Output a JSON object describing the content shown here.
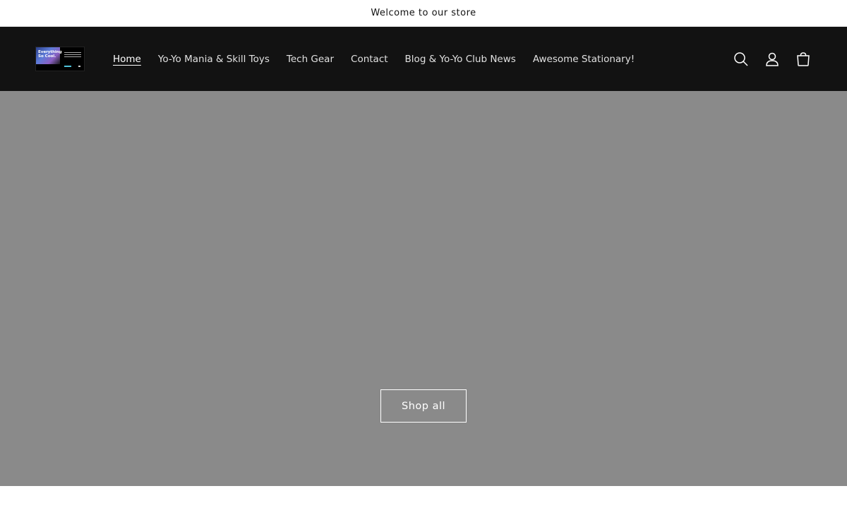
{
  "announcement": {
    "text": "Welcome to our store"
  },
  "header": {
    "logo": {
      "text": "Everything So Cool."
    },
    "nav": [
      {
        "label": "Home",
        "active": true
      },
      {
        "label": "Yo-Yo Mania & Skill Toys",
        "active": false
      },
      {
        "label": "Tech Gear",
        "active": false
      },
      {
        "label": "Contact",
        "active": false
      },
      {
        "label": "Blog & Yo-Yo Club News",
        "active": false
      },
      {
        "label": "Awesome Stationary!",
        "active": false
      }
    ],
    "icons": [
      "search-icon",
      "account-icon",
      "cart-icon"
    ]
  },
  "hero": {
    "background_color": "#8a8a8a",
    "button_label": "Shop all"
  },
  "colors": {
    "header_bg": "#121212",
    "nav_text": "#e0e0e0",
    "announcement_bg": "#ffffff"
  }
}
